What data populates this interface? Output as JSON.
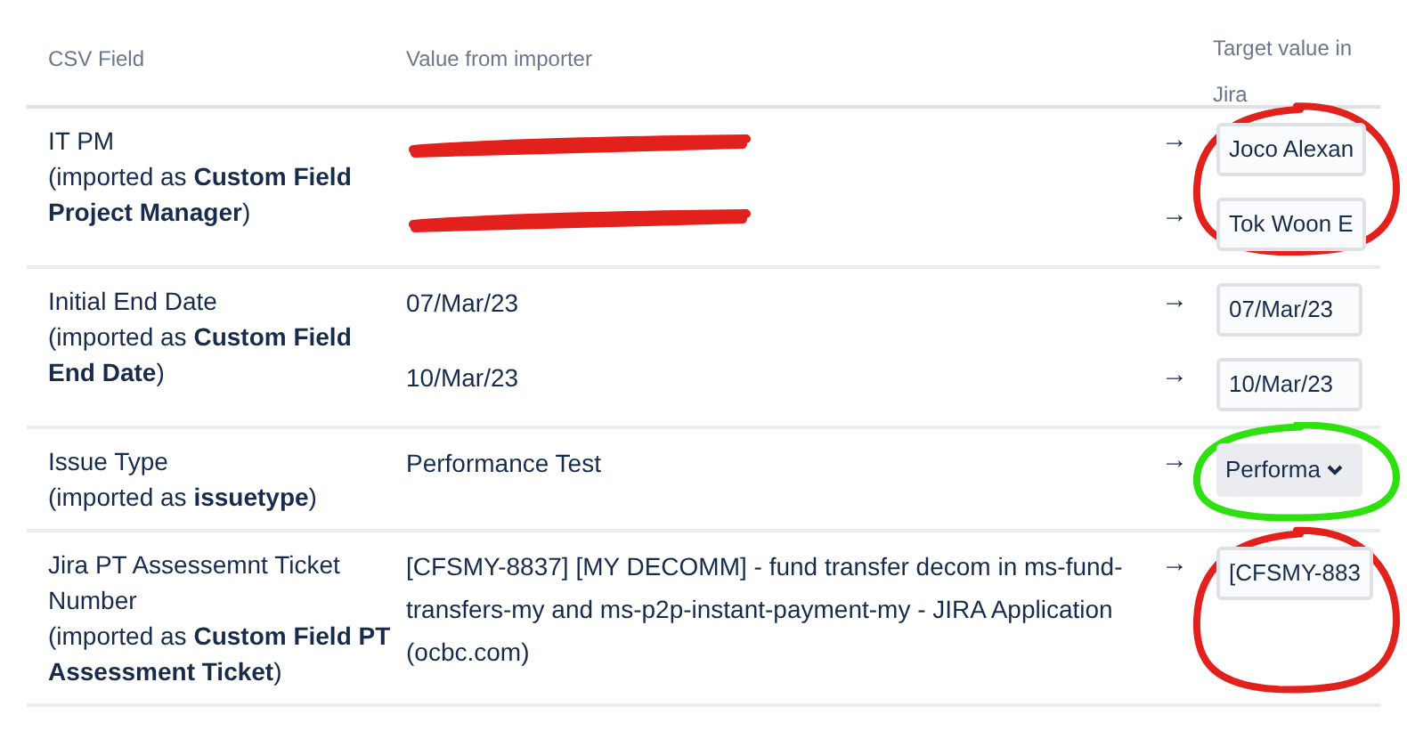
{
  "columns": [
    "CSV Field",
    "Value from importer",
    "Target value in Jira"
  ],
  "rows": [
    {
      "field": "IT PM",
      "imported_as": "(imported as **Custom Field Project Manager**)",
      "annotation": {
        "color": "#e3211c"
      },
      "values": [
        {
          "source": {
            "kind": "redacted"
          },
          "arrow": "→",
          "target": {
            "kind": "input",
            "value": "Joco Alexan"
          }
        },
        {
          "source": {
            "kind": "redacted"
          },
          "arrow": "→",
          "target": {
            "kind": "input",
            "value": "Tok Woon E"
          }
        }
      ]
    },
    {
      "field": "Initial End Date",
      "imported_as": "(imported as **Custom Field End Date**)",
      "values": [
        {
          "source": {
            "kind": "text",
            "text": "07/Mar/23"
          },
          "arrow": "→",
          "target": {
            "kind": "input",
            "value": "07/Mar/23"
          }
        },
        {
          "source": {
            "kind": "text",
            "text": "10/Mar/23"
          },
          "arrow": "→",
          "target": {
            "kind": "input",
            "value": "10/Mar/23"
          }
        }
      ]
    },
    {
      "field": "Issue Type",
      "imported_as": "(imported as **issuetype**)",
      "annotation": {
        "color": "#2ee00e"
      },
      "values": [
        {
          "source": {
            "kind": "text",
            "text": "Performance Test"
          },
          "arrow": "→",
          "target": {
            "kind": "select",
            "value": "Performa"
          }
        }
      ]
    },
    {
      "field": "Jira PT Assessemnt Ticket Number",
      "imported_as": "(imported as **Custom Field PT Assessment Ticket**)",
      "annotation": {
        "color": "#e3211c"
      },
      "values": [
        {
          "source": {
            "kind": "text",
            "text": "[CFSMY-8837] [MY DECOMM] - fund transfer decom in ms-fund-transfers-my and ms-p2p-instant-payment-my - JIRA Application (ocbc.com)"
          },
          "arrow": "→",
          "target": {
            "kind": "input",
            "value": "[CFSMY-883"
          }
        }
      ]
    }
  ]
}
